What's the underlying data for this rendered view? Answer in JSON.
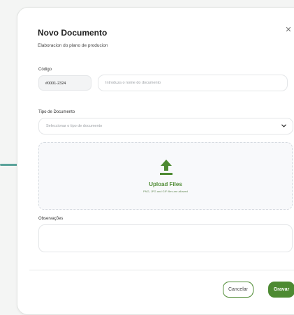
{
  "modal": {
    "title": "Novo Documento",
    "subtitle": "Elaboracion do plano de producion",
    "close_icon": "close-icon"
  },
  "code": {
    "label": "Código",
    "value": "#0001-2324"
  },
  "name": {
    "placeholder": "Introduza o nome do documento"
  },
  "doc_type": {
    "label": "Tipo de Documento",
    "placeholder": "Seleccionar o tipo de documento",
    "icon": "chevron-down-icon"
  },
  "upload": {
    "icon": "upload-icon",
    "title": "Upload Files",
    "hint": "PNG, JPG and GIF files are allowed"
  },
  "notes": {
    "label": "Observações",
    "value": ""
  },
  "actions": {
    "cancel_label": "Cancelar",
    "save_label": "Gravar"
  },
  "colors": {
    "accent": "#4d8a32",
    "side_line": "#5aa39a"
  }
}
